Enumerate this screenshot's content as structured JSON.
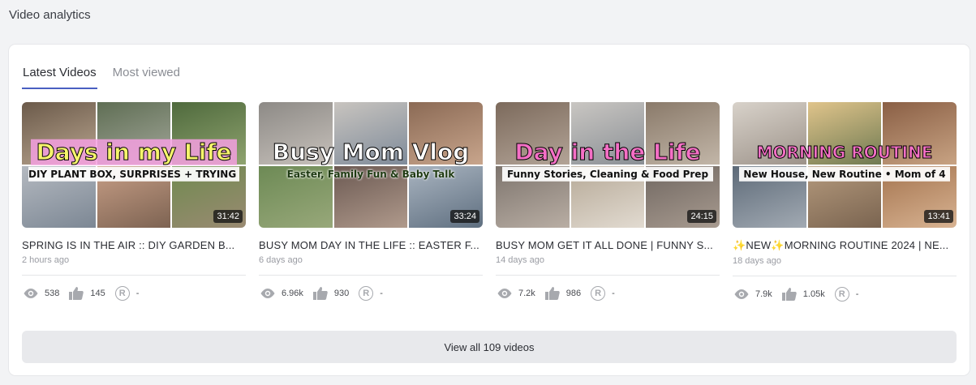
{
  "header": {
    "title": "Video analytics"
  },
  "tabs": [
    {
      "label": "Latest Videos",
      "active": true
    },
    {
      "label": "Most viewed",
      "active": false
    }
  ],
  "videos": [
    {
      "thumb_title": "Days in my Life",
      "thumb_subtitle": "DIY PLANT BOX, SURPRISES + TRYING KETO",
      "thumb_title_color": "#f6f56b",
      "duration": "31:42",
      "title": "SPRING IS IN THE AIR :: DIY GARDEN B...",
      "age": "2 hours ago",
      "views": "538",
      "likes": "145",
      "revenue": "-"
    },
    {
      "thumb_title": "Busy Mom Vlog",
      "thumb_subtitle": "Easter, Family Fun & Baby Talk",
      "thumb_title_color": "#ffffff",
      "duration": "33:24",
      "title": "BUSY MOM DAY IN THE LIFE :: EASTER F...",
      "age": "6 days ago",
      "views": "6.96k",
      "likes": "930",
      "revenue": "-"
    },
    {
      "thumb_title": "Day in the Life",
      "thumb_subtitle": "Funny Stories, Cleaning & Food Prep",
      "thumb_title_color": "#f56fc6",
      "duration": "24:15",
      "title": "BUSY MOM GET IT ALL DONE | FUNNY S...",
      "age": "14 days ago",
      "views": "7.2k",
      "likes": "986",
      "revenue": "-"
    },
    {
      "thumb_title": "MORNING ROUTINE",
      "thumb_subtitle": "New House, New Routine • Mom of 4",
      "thumb_title_color": "#f56fc6",
      "duration": "13:41",
      "title": "✨NEW✨MORNING ROUTINE 2024 | NE...",
      "age": "18 days ago",
      "views": "7.9k",
      "likes": "1.05k",
      "revenue": "-"
    }
  ],
  "footer": {
    "view_all_label": "View all 109 videos"
  },
  "colors": {
    "accent": "#4a5fc1",
    "icon": "#a7a9ae"
  }
}
